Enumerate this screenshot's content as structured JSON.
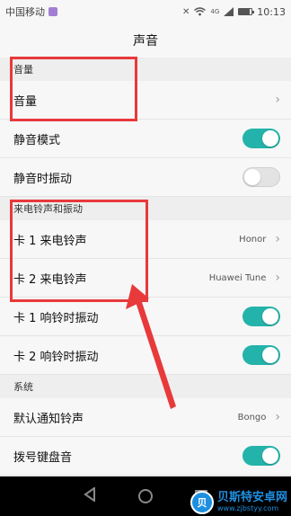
{
  "status_bar": {
    "carrier": "中国移动",
    "network": "4G",
    "time": "10:13",
    "battery_level": 0.85
  },
  "title": "声音",
  "sections": {
    "volume": {
      "header": "音量",
      "items": [
        {
          "label": "音量"
        },
        {
          "label": "静音模式",
          "toggle": true
        },
        {
          "label": "静音时振动",
          "toggle": false
        }
      ]
    },
    "ringtone": {
      "header": "来电铃声和振动",
      "items": [
        {
          "label": "卡 1 来电铃声",
          "value": "Honor"
        },
        {
          "label": "卡 2 来电铃声",
          "value": "Huawei Tune"
        },
        {
          "label": "卡 1 响铃时振动",
          "toggle": true
        },
        {
          "label": "卡 2 响铃时振动",
          "toggle": true
        }
      ]
    },
    "system": {
      "header": "系统",
      "items": [
        {
          "label": "默认通知铃声",
          "value": "Bongo"
        },
        {
          "label": "拨号键盘音",
          "toggle": true
        }
      ]
    }
  },
  "watermark": {
    "title": "贝斯特安卓网",
    "url": "www.zjbstyy.com"
  },
  "colors": {
    "toggle_on": "#24b3aa",
    "annotation": "#e8393b"
  },
  "icons": [
    "sim-card-icon",
    "mute-icon",
    "wifi-icon",
    "signal-icon",
    "battery-icon",
    "chevron-right-icon",
    "back-icon",
    "home-icon",
    "recents-icon"
  ]
}
